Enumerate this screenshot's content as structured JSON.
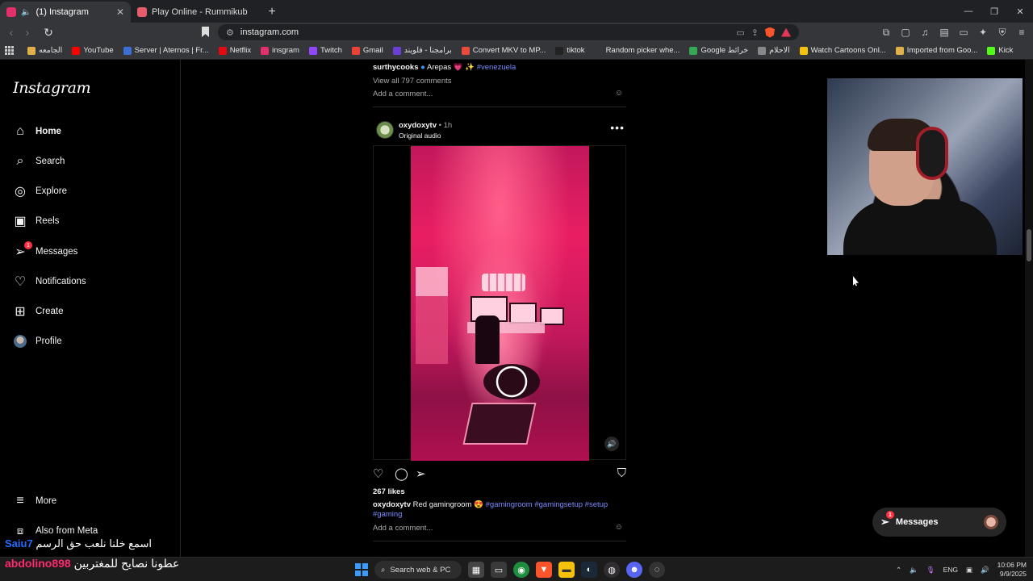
{
  "browser": {
    "tabs": [
      {
        "title": "(1) Instagram",
        "active": true,
        "favicon_color": "#e1306c"
      },
      {
        "title": "Play Online - Rummikub",
        "active": false,
        "favicon_color": "#e35d6a"
      }
    ],
    "url": "instagram.com",
    "bookmarks": [
      {
        "label": "الجامعه",
        "color": "#e0b04a"
      },
      {
        "label": "YouTube",
        "color": "#ff0000"
      },
      {
        "label": "Server | Aternos | Fr...",
        "color": "#3b6fd6"
      },
      {
        "label": "Netflix",
        "color": "#e50914"
      },
      {
        "label": "insgram",
        "color": "#e1306c"
      },
      {
        "label": "Twitch",
        "color": "#9146ff"
      },
      {
        "label": "Gmail",
        "color": "#ea4335"
      },
      {
        "label": "برامجنا - فلويند",
        "color": "#6b3fd6"
      },
      {
        "label": "Convert MKV to MP...",
        "color": "#e94b3c"
      },
      {
        "label": "tiktok",
        "color": "#222222"
      },
      {
        "label": "Random picker whe...",
        "color": "#35363a"
      },
      {
        "label": "Google خرائط",
        "color": "#34a853"
      },
      {
        "label": "الاحلام",
        "color": "#888888"
      },
      {
        "label": "Watch Cartoons Onl...",
        "color": "#f4c20d"
      },
      {
        "label": "Imported from Goo...",
        "color": "#e0b04a"
      },
      {
        "label": "Kick",
        "color": "#53fc18"
      }
    ]
  },
  "sidebar": {
    "logo": "Instagram",
    "items": [
      {
        "label": "Home",
        "icon": "home-icon",
        "glyph": "⌂"
      },
      {
        "label": "Search",
        "icon": "search-icon",
        "glyph": "⌕"
      },
      {
        "label": "Explore",
        "icon": "explore-icon",
        "glyph": "◎"
      },
      {
        "label": "Reels",
        "icon": "reels-icon",
        "glyph": "▣"
      },
      {
        "label": "Messages",
        "icon": "messages-icon",
        "glyph": "➢",
        "badge": "1"
      },
      {
        "label": "Notifications",
        "icon": "heart-icon",
        "glyph": "♡"
      },
      {
        "label": "Create",
        "icon": "create-icon",
        "glyph": "⊞"
      },
      {
        "label": "Profile",
        "icon": "avatar-icon",
        "glyph": ""
      }
    ],
    "more": "More",
    "also_from_meta": "Also from Meta"
  },
  "prev_post": {
    "username": "surthycooks",
    "caption": " Arepas 💗 ✨ ",
    "hashtag": "#venezuela",
    "view_comments": "View all 797 comments",
    "add_comment": "Add a comment..."
  },
  "post": {
    "username": "oxydoxytv",
    "time": "• 1h",
    "audio": "Original audio",
    "likes": "267 likes",
    "caption_user": "oxydoxytv",
    "caption_text": " Red gamingroom 😍 ",
    "hashtags": "#gamingroom #gamingsetup #setup #gaming",
    "add_comment": "Add a comment..."
  },
  "messages_pill": {
    "label": "Messages",
    "badge": "1"
  },
  "overlay": {
    "line1_name": "Saiu7",
    "line1_text": "اسمع خلنا نلعب حق الرسم",
    "line2_name": "abdolino898",
    "line2_text": "عطونا نصايح للمغتربين",
    "name_color": "#1e6eff",
    "name2_color": "#ff2a6d"
  },
  "taskbar": {
    "search_placeholder": "Search web & PC",
    "lang": "ENG",
    "time": "10:06 PM",
    "date": "9/9/2025"
  }
}
